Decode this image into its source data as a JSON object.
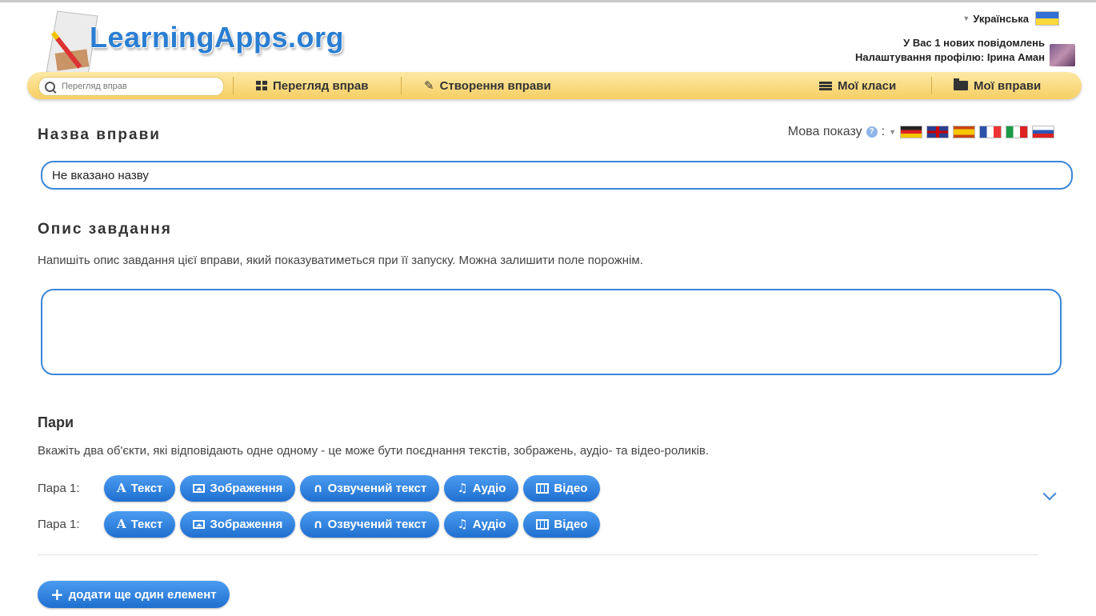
{
  "header": {
    "logo": "LearningApps.org",
    "language": "Українська",
    "messages": "У Вас 1 нових повідомлень",
    "profile": "Налаштування профілю: Ірина Аман"
  },
  "nav": {
    "search_placeholder": "Перегляд вправ",
    "browse": "Перегляд вправ",
    "create": "Створення вправи",
    "classes": "Мої класи",
    "my_apps": "Мої вправи"
  },
  "form": {
    "title_label": "Назва вправи",
    "display_language_label": "Мова показу",
    "display_language_sep": ":",
    "help_glyph": "?",
    "title_value": "Не вказано назву",
    "description_label": "Опис завдання",
    "description_help": "Напишіть опис завдання цієї вправи, який показуватиметься при її запуску. Можна залишити поле порожнім.",
    "description_value": ""
  },
  "pairs": {
    "heading": "Пари",
    "help": "Вкажіть два об'єкти, які відповідають одне одному - це може бути поєднання текстів, зображень, аудіо- та відео-роликів.",
    "rows": [
      {
        "label": "Пара 1:",
        "text": "Текст",
        "image": "Зображення",
        "tts": "Озвучений текст",
        "audio": "Аудіо",
        "video": "Відео"
      },
      {
        "label": "Пара 1:",
        "text": "Текст",
        "image": "Зображення",
        "tts": "Озвучений текст",
        "audio": "Аудіо",
        "video": "Відео"
      }
    ],
    "add_button": "додати ще один елемент"
  },
  "icons": [
    "search-icon",
    "grid-icon",
    "pencil-icon",
    "list-icon",
    "folder-icon",
    "help-icon",
    "text-icon",
    "image-icon",
    "headphones-icon",
    "music-icon",
    "film-icon",
    "plus-icon",
    "chevron-down-icon"
  ],
  "colors": {
    "accent": "#2a7ed2",
    "navbar": "#f6cf63",
    "button": "#1f6fd0"
  }
}
